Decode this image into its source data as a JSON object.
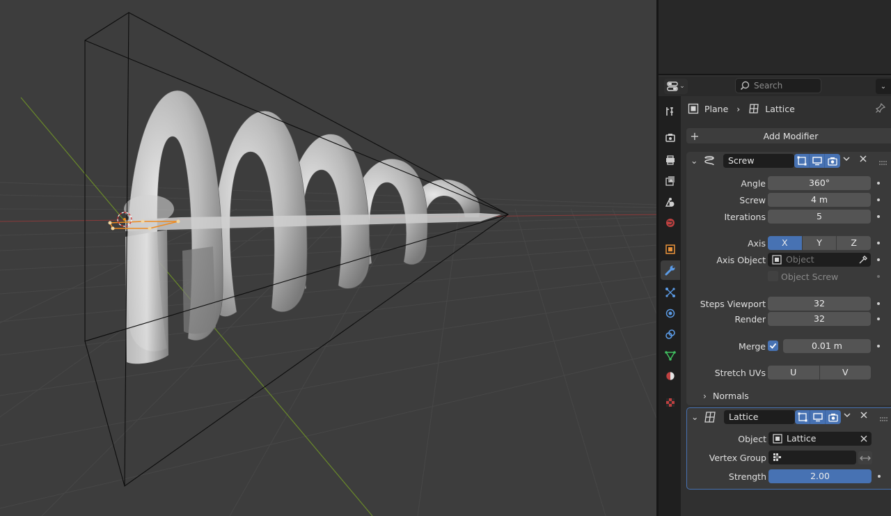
{
  "header": {
    "search_placeholder": "Search"
  },
  "breadcrumb": {
    "object": "Plane",
    "data": "Lattice"
  },
  "add_modifier_label": "Add Modifier",
  "screw": {
    "name": "Screw",
    "angle_label": "Angle",
    "angle": "360°",
    "screw_label": "Screw",
    "screw": "4 m",
    "iterations_label": "Iterations",
    "iterations": "5",
    "axis_label": "Axis",
    "axis_options": [
      "X",
      "Y",
      "Z"
    ],
    "axis_selected": "X",
    "axis_object_label": "Axis Object",
    "axis_object_placeholder": "Object",
    "object_screw_label": "Object Screw",
    "steps_viewport_label": "Steps Viewport",
    "steps_viewport": "32",
    "render_label": "Render",
    "render": "32",
    "merge_label": "Merge",
    "merge_checked": true,
    "merge_value": "0.01 m",
    "stretch_uvs_label": "Stretch UVs",
    "stretch_u": "U",
    "stretch_v": "V",
    "normals_label": "Normals"
  },
  "lattice": {
    "name": "Lattice",
    "object_label": "Object",
    "object_value": "Lattice",
    "vertex_group_label": "Vertex Group",
    "vertex_group_value": "",
    "strength_label": "Strength",
    "strength": "2.00"
  },
  "tabs": [
    "tool",
    "render",
    "output",
    "view-layer",
    "scene",
    "world",
    "object",
    "modifiers",
    "particles",
    "physics",
    "constraints",
    "data",
    "material",
    "texture"
  ],
  "colors": {
    "accent": "#4772b3",
    "x_axis": "#8a3a3a",
    "y_axis": "#6a8a2a",
    "selection": "#f08a1c"
  }
}
